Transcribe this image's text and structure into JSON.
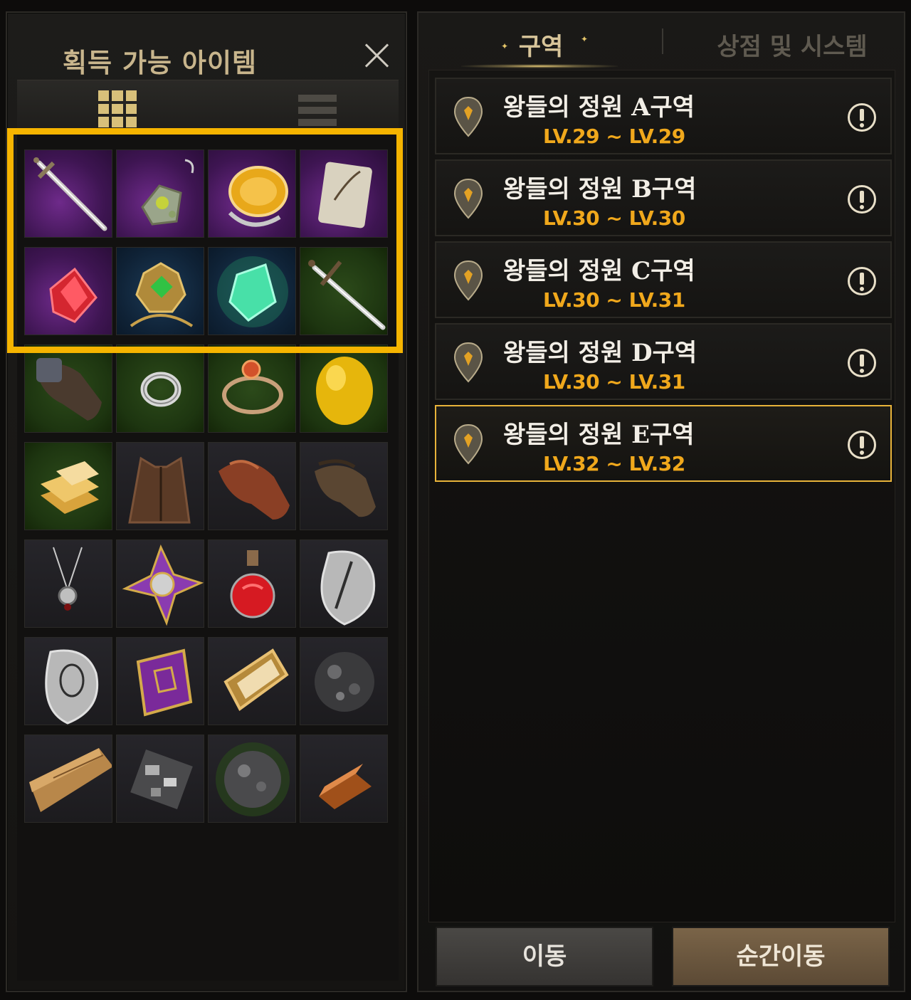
{
  "left_panel": {
    "title": "획득 가능 아이템"
  },
  "items": [
    {
      "name": "longsword",
      "bg": "purple"
    },
    {
      "name": "jeweled-earring",
      "bg": "purple"
    },
    {
      "name": "amber-ring",
      "bg": "purple"
    },
    {
      "name": "sword-scroll",
      "bg": "purple"
    },
    {
      "name": "red-crystal",
      "bg": "purple"
    },
    {
      "name": "emerald-amulet",
      "bg": "blue"
    },
    {
      "name": "green-crystal",
      "bg": "blue"
    },
    {
      "name": "sword",
      "bg": "green"
    },
    {
      "name": "leather-gauntlets",
      "bg": "green"
    },
    {
      "name": "silver-ring",
      "bg": "green"
    },
    {
      "name": "ruby-ring",
      "bg": "green"
    },
    {
      "name": "golden-egg",
      "bg": "green"
    },
    {
      "name": "gold-bars",
      "bg": "green"
    },
    {
      "name": "leather-vest",
      "bg": "dark"
    },
    {
      "name": "leather-gloves",
      "bg": "dark"
    },
    {
      "name": "fingerless-gloves",
      "bg": "dark"
    },
    {
      "name": "pendant-necklace",
      "bg": "dark"
    },
    {
      "name": "purple-emblem",
      "bg": "dark"
    },
    {
      "name": "red-potion",
      "bg": "dark"
    },
    {
      "name": "silver-sword-stone",
      "bg": "dark"
    },
    {
      "name": "silver-necklace-stone",
      "bg": "dark"
    },
    {
      "name": "purple-book",
      "bg": "dark"
    },
    {
      "name": "gold-scroll",
      "bg": "dark"
    },
    {
      "name": "black-ore",
      "bg": "dark"
    },
    {
      "name": "wood-planks",
      "bg": "dark"
    },
    {
      "name": "metal-scraps",
      "bg": "dark"
    },
    {
      "name": "dark-ore",
      "bg": "dark"
    },
    {
      "name": "copper-ingot",
      "bg": "dark"
    }
  ],
  "right_panel": {
    "tabs": [
      {
        "label": "구역",
        "active": true
      },
      {
        "label": "상점 및 시스템",
        "active": false
      }
    ],
    "zones": [
      {
        "name": "왕들의 정원 A구역",
        "level": "LV.29 ~ LV.29",
        "selected": false
      },
      {
        "name": "왕들의 정원 B구역",
        "level": "LV.30 ~ LV.30",
        "selected": false
      },
      {
        "name": "왕들의 정원 C구역",
        "level": "LV.30 ~ LV.31",
        "selected": false
      },
      {
        "name": "왕들의 정원 D구역",
        "level": "LV.30 ~ LV.31",
        "selected": false
      },
      {
        "name": "왕들의 정원 E구역",
        "level": "LV.32 ~ LV.32",
        "selected": true
      }
    ],
    "move_label": "이동",
    "teleport_label": "순간이동"
  },
  "colors": {
    "highlight": "#f6b400",
    "level_text": "#f0a81c",
    "selected_border": "#e8b33a",
    "active_tab": "#d8c59a"
  }
}
